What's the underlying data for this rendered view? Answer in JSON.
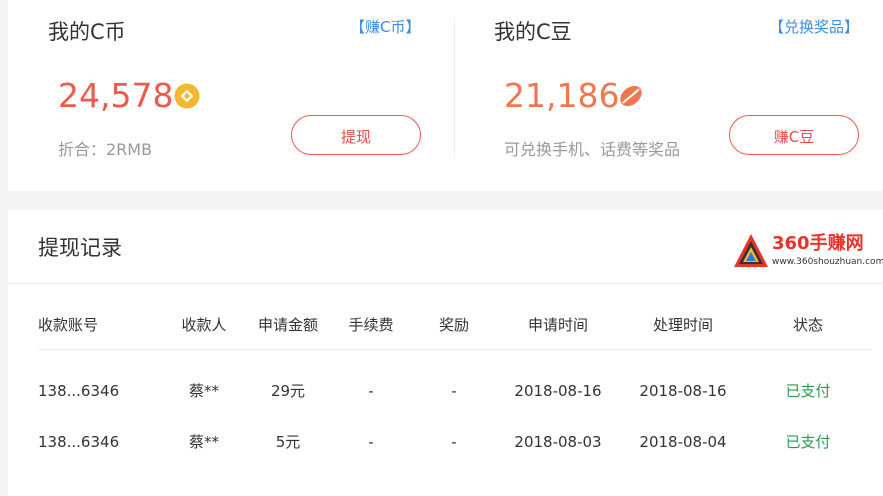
{
  "coin_panel": {
    "title": "我的C币",
    "link_label": "【赚C币】",
    "amount": "24,578",
    "equivalent": "折合：2RMB",
    "button_label": "提现",
    "icon": "coin-icon",
    "icon_color": "#f5b731"
  },
  "bean_panel": {
    "title": "我的C豆",
    "link_label": "【兑换奖品】",
    "amount": "21,186",
    "description": "可兑换手机、话费等奖品",
    "button_label": "赚C豆",
    "icon": "coffee-bean-icon",
    "icon_color": "#f2764f"
  },
  "records": {
    "title": "提现记录",
    "logo_text": "360手赚网",
    "logo_sub": "www.360shouzhuan.com",
    "columns": [
      "收款账号",
      "收款人",
      "申请金额",
      "手续费",
      "奖励",
      "申请时间",
      "处理时间",
      "状态"
    ],
    "rows": [
      [
        "138...6346",
        "蔡**",
        "29元",
        "-",
        "-",
        "2018-08-16",
        "2018-08-16",
        "已支付"
      ],
      [
        "138...6346",
        "蔡**",
        "5元",
        "-",
        "-",
        "2018-08-03",
        "2018-08-04",
        "已支付"
      ]
    ]
  },
  "colors": {
    "accent_red": "#f05a4e",
    "link_blue": "#3a8ee6",
    "status_green": "#2d9b4f"
  }
}
